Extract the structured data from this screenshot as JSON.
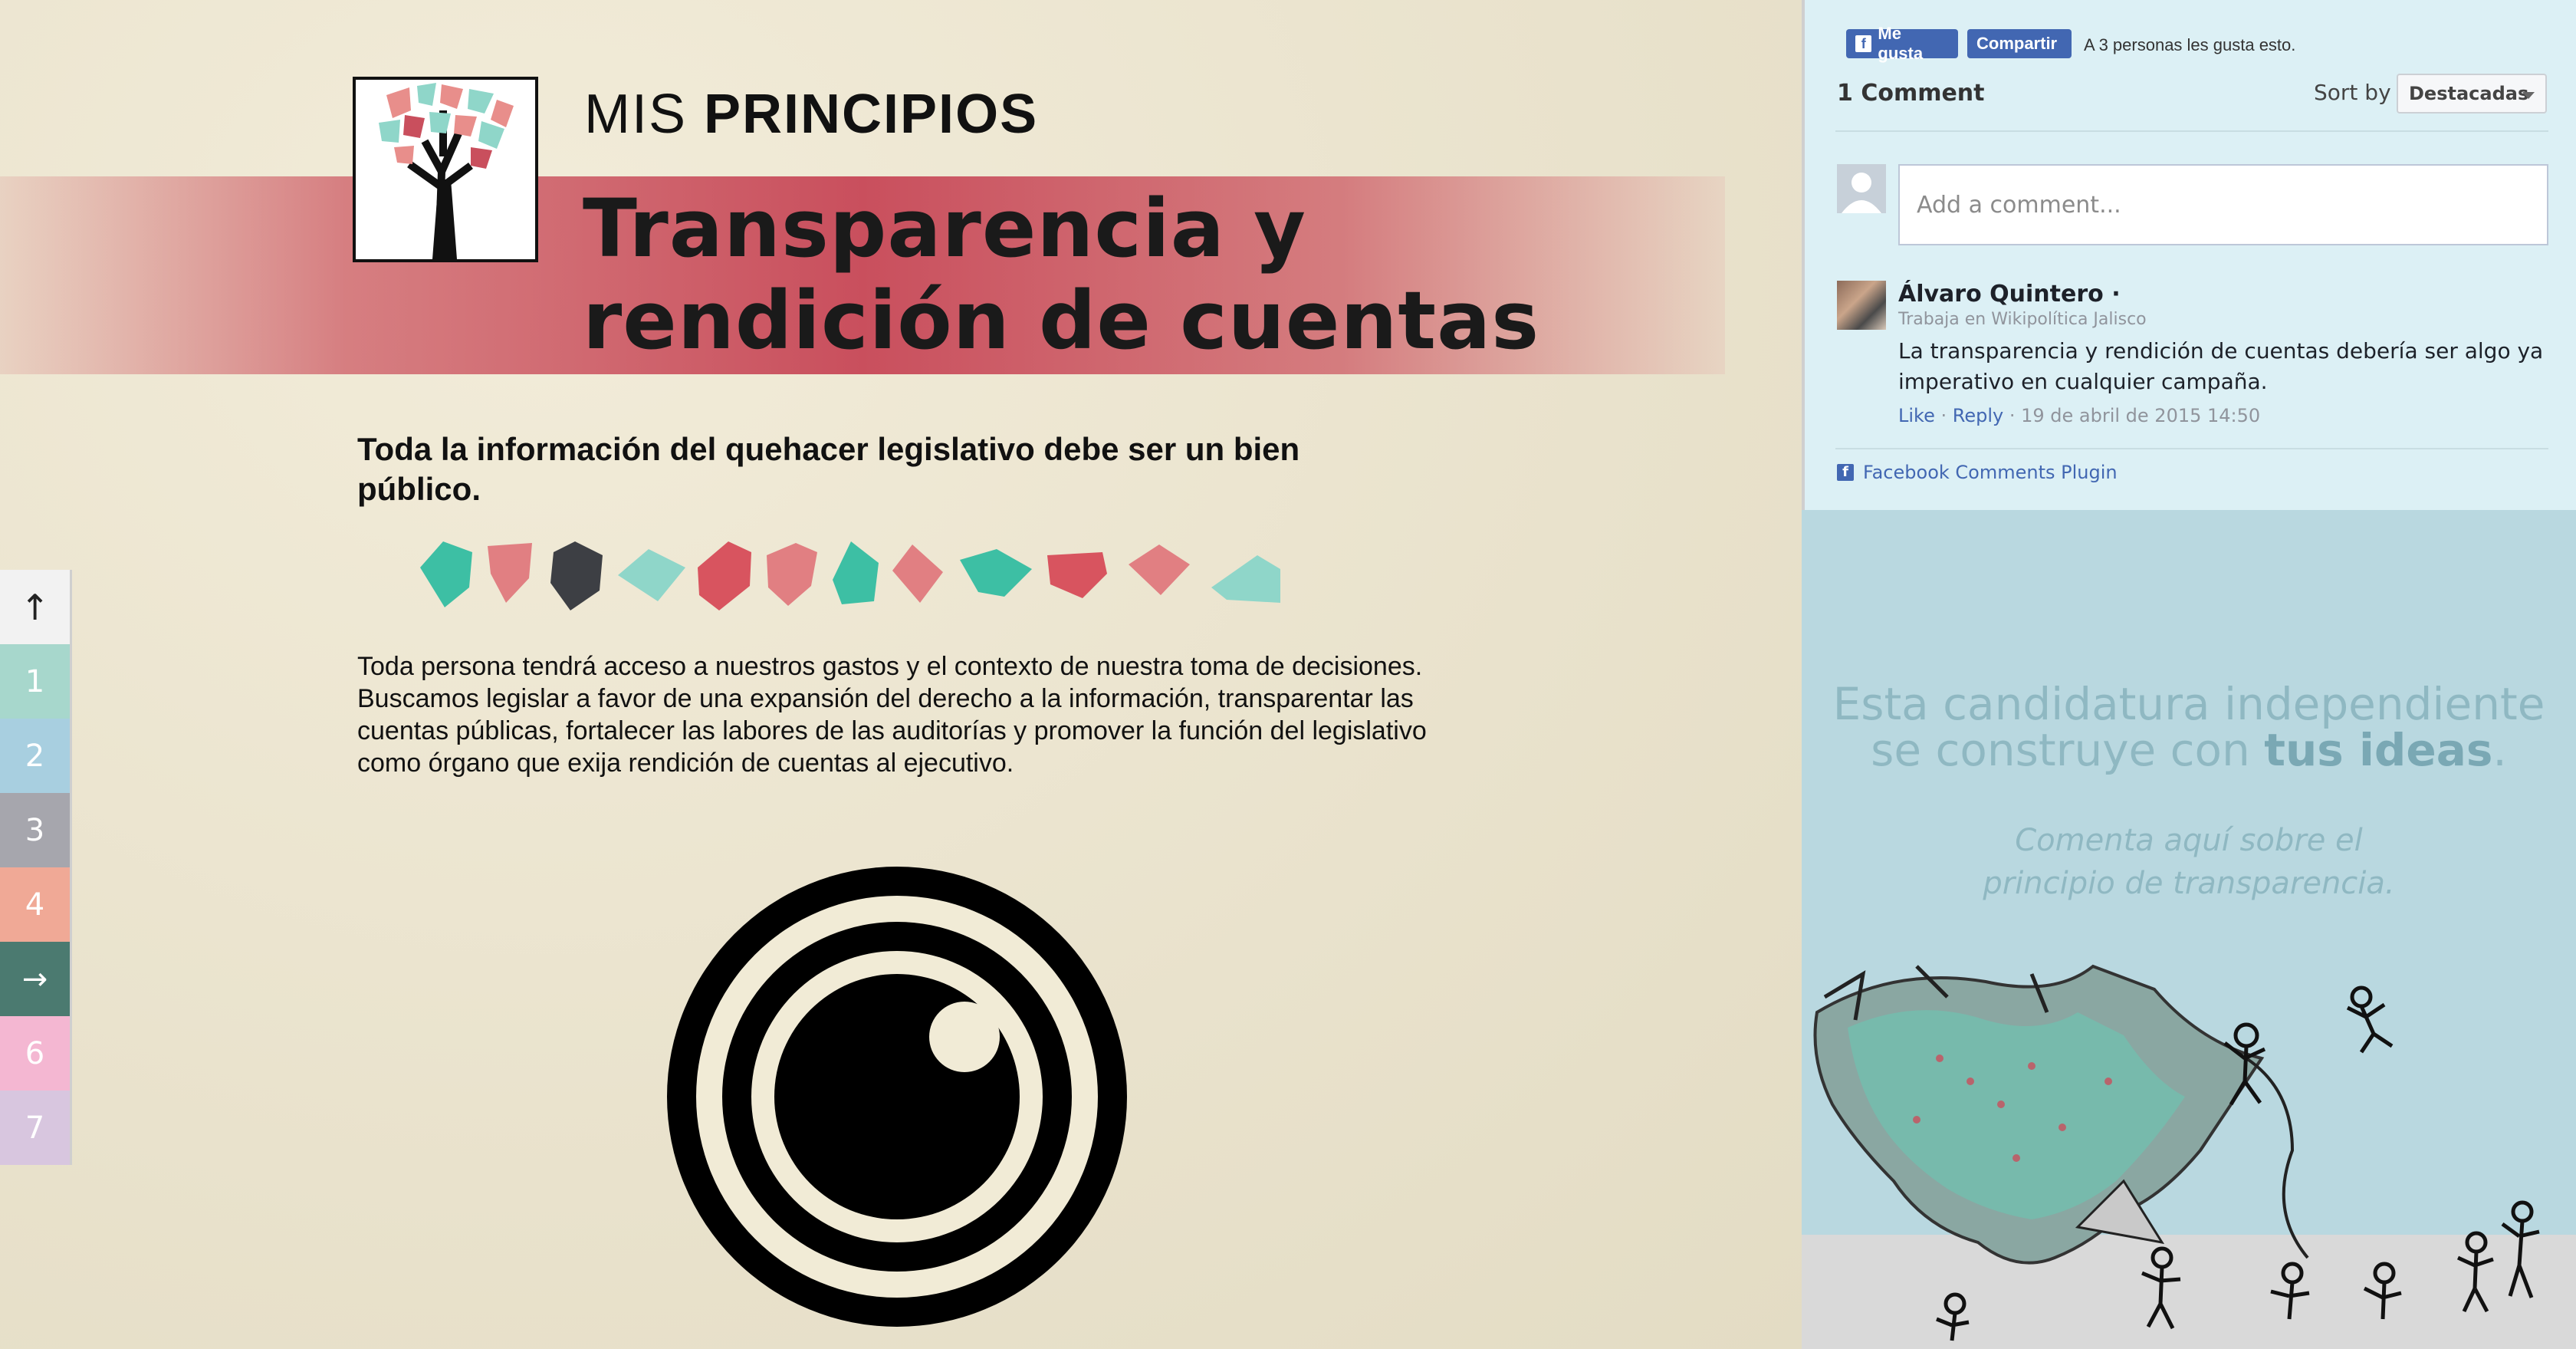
{
  "header": {
    "mis_light": "MIS ",
    "mis_bold": "PRINCIPIOS",
    "title_line1": "Transparencia y",
    "title_line2": "rendición de cuentas"
  },
  "content": {
    "subtitle": "Toda la información del quehacer legislativo debe ser un bien público.",
    "body": "Toda persona tendrá acceso a nuestros gastos y el contexto de nuestra toma de decisiones. Buscamos legislar a favor de una expansión del derecho a la información, transparentar las cuentas públicas, fortalecer las labores de las auditorías y promover la función del legislativo como órgano que exija rendición de cuentas al ejecutivo."
  },
  "sidenav": {
    "items": [
      {
        "label": "↑",
        "color": "#f2f2f2"
      },
      {
        "label": "1",
        "color": "#a7d7cc"
      },
      {
        "label": "2",
        "color": "#a8cfe0"
      },
      {
        "label": "3",
        "color": "#a6a6ad"
      },
      {
        "label": "4",
        "color": "#f0a996"
      },
      {
        "label": "→",
        "color": "#4b7a70"
      },
      {
        "label": "6",
        "color": "#f4b7d2"
      },
      {
        "label": "7",
        "color": "#d8c6df"
      }
    ]
  },
  "facebook": {
    "like_label": "Me gusta",
    "like_icon": "f",
    "share_label": "Compartir",
    "likes_text": "A 3 personas les gusta esto.",
    "comment_count": "1 Comment",
    "sort_label": "Sort by",
    "sort_value": "Destacadas",
    "input_placeholder": "Add a comment...",
    "comment": {
      "author": "Álvaro Quintero ·",
      "work": "Trabaja en Wikipolítica Jalisco",
      "text": "La transparencia y rendición de cuentas debería ser algo ya imperativo en cualquier campaña.",
      "like": "Like",
      "dot1": " · ",
      "reply": "Reply",
      "dot2": " · ",
      "date": "19 de abril de 2015 14:50"
    },
    "plugin_icon": "f",
    "plugin_label": "Facebook Comments Plugin"
  },
  "cta": {
    "line1": "Esta candidatura independiente",
    "line2_pre": "se construye con ",
    "line2_strong": "tus ideas",
    "line2_post": ".",
    "line3": "Comenta aquí sobre el principio de transparencia."
  },
  "colors": {
    "banner": "#c94f5d",
    "teal": "#3dbfa4",
    "pink": "#e17f82",
    "dark": "#3d3f44",
    "light_teal": "#8fd6c9",
    "red": "#d8545f",
    "fb_blue": "#4267b2"
  }
}
